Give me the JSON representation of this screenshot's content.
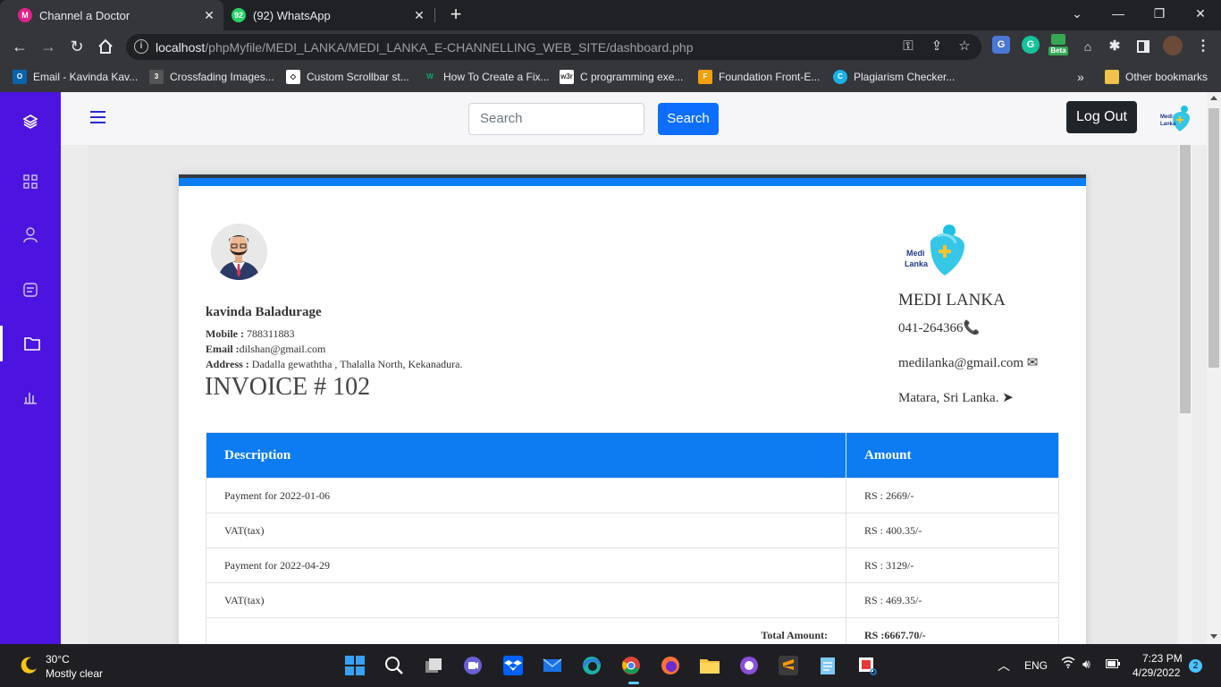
{
  "browser": {
    "tabs": [
      {
        "title": "Channel a Doctor",
        "favicon": "medi-lanka-favicon",
        "active": true
      },
      {
        "title": "(92) WhatsApp",
        "favicon": "whatsapp-icon",
        "badge": "92",
        "active": false
      }
    ],
    "url_host": "localhost",
    "url_path": "/phpMyfile/MEDI_LANKA/MEDI_LANKA_E-CHANNELLING_WEB_SITE/dashboard.php",
    "extension_beta_label": "Beta",
    "bookmarks": [
      {
        "label": "Email - Kavinda Kav...",
        "icon": "outlook-icon"
      },
      {
        "label": "Crossfading Images...",
        "icon": "css3-icon"
      },
      {
        "label": "Custom Scrollbar st...",
        "icon": "codepen-icon"
      },
      {
        "label": "How To Create a Fix...",
        "icon": "w3schools-icon"
      },
      {
        "label": "C programming exe...",
        "icon": "w3resource-icon"
      },
      {
        "label": "Foundation Front-E...",
        "icon": "foundation-icon"
      },
      {
        "label": "Plagiarism Checker...",
        "icon": "plagiarism-icon"
      }
    ],
    "more_bookmarks": "»",
    "other_bookmarks": "Other bookmarks"
  },
  "topnav": {
    "search_placeholder": "Search",
    "search_button": "Search",
    "logout_button": "Log Out"
  },
  "customer": {
    "name": "kavinda Baladurage",
    "mobile_label": "Mobile :",
    "mobile": " 788311883",
    "email_label": "Email :",
    "email": "dilshan@gmail.com",
    "address_label": "Address :",
    "address": " Dadalla gewaththa , Thalalla North, Kekanadura."
  },
  "invoice": {
    "title": "INVOICE # 102",
    "columns": [
      "Description",
      "Amount"
    ],
    "rows": [
      {
        "description": "Payment for 2022-01-06",
        "amount": "RS : 2669/-"
      },
      {
        "description": "VAT(tax)",
        "amount": "RS : 400.35/-"
      },
      {
        "description": "Payment for 2022-04-29",
        "amount": "RS : 3129/-"
      },
      {
        "description": "VAT(tax)",
        "amount": "RS : 469.35/-"
      }
    ],
    "total_label": "Total Amount:",
    "total_value": "RS :6667.70/-"
  },
  "clinic": {
    "logo_text_top": "Medi",
    "logo_text_bottom": "Lanka",
    "name": "MEDI LANKA",
    "phone": "041-264366",
    "email": "medilanka@gmail.com",
    "location": "Matara, Sri Lanka."
  },
  "taskbar": {
    "temperature": "30°C",
    "condition": "Mostly clear",
    "language": "ENG",
    "time": "7:23 PM",
    "date": "4/29/2022",
    "notification_count": "2"
  },
  "colors": {
    "sidebar": "#4d14e0",
    "primary_blue": "#0d7cf2",
    "dark": "#212529"
  }
}
